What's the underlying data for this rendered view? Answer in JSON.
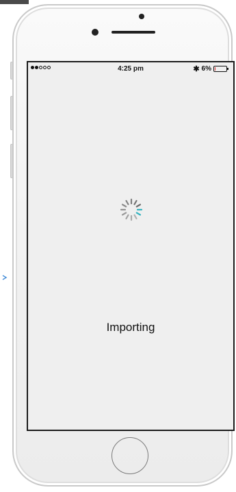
{
  "status_bar": {
    "signal_filled": 2,
    "signal_total": 5,
    "time": "4:25 pm",
    "bluetooth_icon": "bluetooth-icon",
    "battery_text": "6%",
    "battery_level": 0.06,
    "battery_color": "#e03030"
  },
  "main": {
    "spinner_icon": "loading-spinner-icon",
    "label": "Importing",
    "spinner_accent": "#36b3c0"
  },
  "device": {
    "home_button_icon": "home-button-icon"
  }
}
